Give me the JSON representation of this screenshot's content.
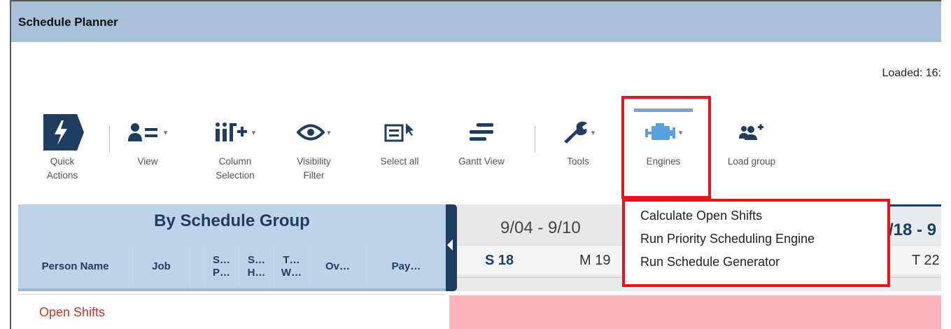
{
  "window": {
    "title": "Schedule Planner"
  },
  "status": {
    "loaded": "Loaded: 16:"
  },
  "toolbar": {
    "quick_actions": "Quick Actions",
    "view": "View",
    "column_selection": "Column Selection",
    "visibility_filter": "Visibility Filter",
    "select_all": "Select all",
    "gantt_view": "Gantt View",
    "tools": "Tools",
    "engines": "Engines",
    "load_group": "Load group"
  },
  "engines_menu": {
    "items": [
      "Calculate Open Shifts",
      "Run Priority Scheduling Engine",
      "Run Schedule Generator"
    ]
  },
  "left_panel": {
    "title": "By Schedule Group",
    "columns": [
      "Person Name",
      "Job",
      "S… P…",
      "S… H…",
      "T… W…",
      "Ov…",
      "Pay…"
    ]
  },
  "calendar": {
    "weeks": [
      "9/04 - 9/10",
      "/18 - 9"
    ],
    "days": [
      "S 18",
      "M 19",
      "T 22"
    ]
  },
  "rows": {
    "first_row": "Open Shifts"
  },
  "colors": {
    "title_bar": "#a9c1d8",
    "accent": "#1f3d5e",
    "highlight": "#e8141a",
    "open_shift_bg": "#ffb3ba"
  }
}
